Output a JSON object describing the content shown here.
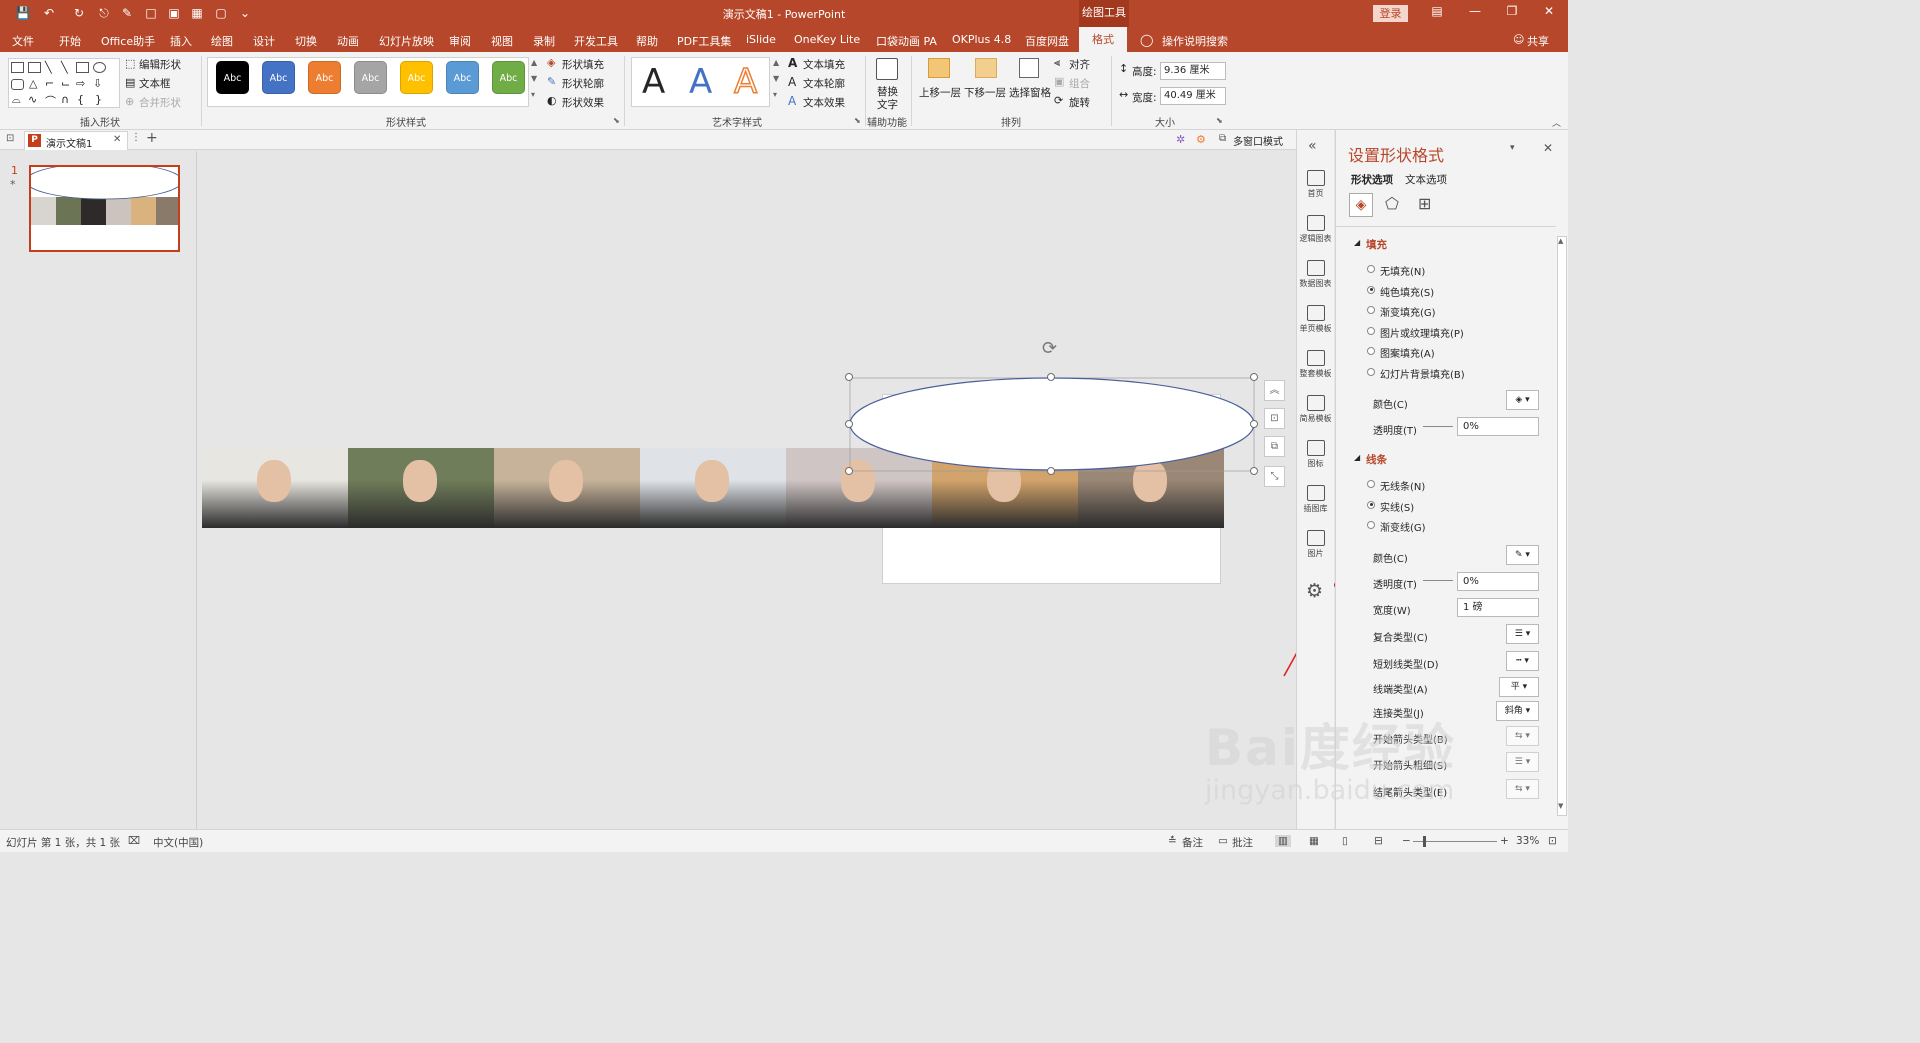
{
  "titlebar": {
    "doc_title": "演示文稿1  -  PowerPoint",
    "context_tab": "绘图工具",
    "login_label": "登录",
    "accent": "#b7472a"
  },
  "menu": {
    "tabs": [
      "文件",
      "开始",
      "Office助手",
      "插入",
      "绘图",
      "设计",
      "切换",
      "动画",
      "幻灯片放映",
      "审阅",
      "视图",
      "录制",
      "开发工具",
      "帮助",
      "PDF工具集",
      "iSlide",
      "OneKey Lite",
      "口袋动画 PA",
      "OKPlus 4.8",
      "百度网盘"
    ],
    "active_tab": "格式",
    "search_label": "操作说明搜索",
    "share_label": "共享"
  },
  "ribbon": {
    "insert_shapes": {
      "label": "插入形状",
      "edit_shape": "编辑形状",
      "text_box": "文本框",
      "merge_shapes": "合并形状"
    },
    "shape_styles": {
      "label": "形状样式",
      "swatch_text": "Abc",
      "swatch_colors": [
        "#000000",
        "#4472c4",
        "#ed7d31",
        "#a5a5a5",
        "#ffc000",
        "#5b9bd5",
        "#70ad47"
      ],
      "fill": "形状填充",
      "outline": "形状轮廓",
      "effects": "形状效果"
    },
    "wordart": {
      "label": "艺术字样式",
      "letter": "A",
      "colors": [
        "#000000",
        "#4472c4",
        "#ed7d31"
      ],
      "text_fill": "文本填充",
      "text_outline": "文本轮廓",
      "text_effects": "文本效果"
    },
    "accessibility": {
      "label": "辅助功能",
      "alt_text_1": "替换",
      "alt_text_2": "文字"
    },
    "arrange": {
      "label": "排列",
      "bring_forward": "上移一层",
      "send_backward": "下移一层",
      "selection_pane": "选择窗格",
      "align": "对齐",
      "group": "组合",
      "rotate": "旋转"
    },
    "size": {
      "label": "大小",
      "height_label": "高度:",
      "height_value": "9.36 厘米",
      "width_label": "宽度:",
      "width_value": "40.49 厘米"
    }
  },
  "docstrip": {
    "tab_name": "演示文稿1",
    "multi_window": "多窗口模式"
  },
  "thumbnails": {
    "slide_number": "1",
    "star": "*"
  },
  "islide": {
    "items": [
      "首页",
      "逻辑图表",
      "数据图表",
      "单页模板",
      "整套模板",
      "简易模板",
      "图标",
      "插图库",
      "图片"
    ]
  },
  "panel": {
    "title": "设置形状格式",
    "tab_shape": "形状选项",
    "tab_text": "文本选项",
    "fill_section": "填充",
    "fill_options": [
      "无填充(N)",
      "纯色填充(S)",
      "渐变填充(G)",
      "图片或纹理填充(P)",
      "图案填充(A)",
      "幻灯片背景填充(B)"
    ],
    "fill_selected": 1,
    "color_label": "颜色(C)",
    "transparency_label": "透明度(T)",
    "transparency_value": "0%",
    "line_section": "线条",
    "line_options": [
      "无线条(N)",
      "实线(S)",
      "渐变线(G)"
    ],
    "line_selected": 1,
    "line_color_label": "颜色(C)",
    "line_transparency_label": "透明度(T)",
    "line_transparency_value": "0%",
    "width_label": "宽度(W)",
    "width_value": "1 磅",
    "compound_label": "复合类型(C)",
    "dash_label": "短划线类型(D)",
    "cap_label": "线端类型(A)",
    "cap_value": "平",
    "join_label": "连接类型(J)",
    "join_value": "斜角",
    "begin_arrow_label": "开始箭头类型(B)",
    "begin_size_label": "开始箭头粗细(S)",
    "end_arrow_label": "结尾箭头类型(E)"
  },
  "statusbar": {
    "slide_info": "幻灯片 第 1 张，共 1 张",
    "language": "中文(中国)",
    "notes": "备注",
    "comments": "批注",
    "zoom": "33%"
  },
  "watermark": {
    "line1": "Bai度经验",
    "line2": "jingyan.baidu.com"
  },
  "photos": {
    "colors": [
      "#e8e6e0",
      "#6f7d5a",
      "#c7b39a",
      "#dfe3e8",
      "#cfc5c4",
      "#d2a36a",
      "#9a8775"
    ]
  }
}
